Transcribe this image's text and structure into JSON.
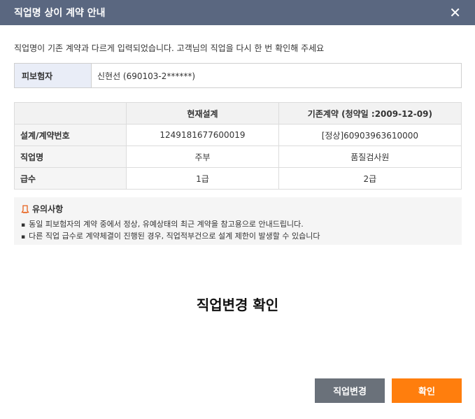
{
  "dialog": {
    "title": "직업명 상이 계약 안내",
    "intro": "직업명이 기존 계약과 다르게 입력되었습니다. 고객님의 직업을 다시 한 번 확인해 주세요",
    "insured_label": "피보험자",
    "insured_value": "신현선 (690103-2******)",
    "table": {
      "headers": [
        "",
        "현재설계",
        "기존계약 (청약일 :2009-12-09)"
      ],
      "rows": [
        {
          "label": "설계/계약번호",
          "current": "1249181677600019",
          "existing": "[정상]60903963610000"
        },
        {
          "label": "직업명",
          "current": "주부",
          "existing": "품질검사원"
        },
        {
          "label": "급수",
          "current": "1급",
          "existing": "2급"
        }
      ]
    },
    "notice": {
      "title": "유의사항",
      "items": [
        "동일 피보험자의 계약 중에서 정상, 유예상태의 최근 계약을 참고용으로 안내드립니다.",
        "다른 직업 급수로 계약체결이 진행된 경우, 직업적부건으로 설계 제한이 발생할 수 있습니다"
      ]
    },
    "confirm_heading": "직업변경 확인",
    "buttons": {
      "change": "직업변경",
      "ok": "확인"
    },
    "close_glyph": "✕",
    "colors": {
      "titlebar": "#5a6780",
      "accent": "#ff7e0d",
      "secondary_button": "#6a717a",
      "label_bg": "#e9edf7"
    },
    "icons": {
      "notice": "notice-icon",
      "close": "close-icon"
    }
  }
}
